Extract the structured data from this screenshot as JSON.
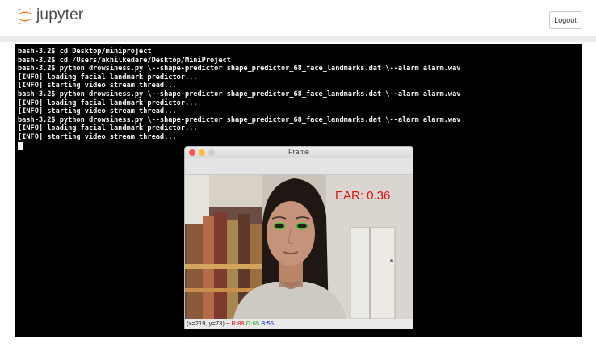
{
  "header": {
    "brand": "jupyter",
    "logout_label": "Logout"
  },
  "terminal": {
    "lines": [
      "bash-3.2$ cd Desktop/miniproject",
      "bash-3.2$ cd /Users/akhilkedare/Desktop/MiniProject",
      "bash-3.2$ python drowsiness.py \\--shape-predictor shape_predictor_68_face_landmarks.dat \\--alarm alarm.wav",
      "[INFO] loading facial landmark predictor...",
      "[INFO] starting video stream thread...",
      "bash-3.2$ python drowsiness.py \\--shape-predictor shape_predictor_68_face_landmarks.dat \\--alarm alarm.wav",
      "[INFO] loading facial landmark predictor...",
      "[INFO] starting video stream thread...",
      "bash-3.2$ python drowsiness.py \\--shape-predictor shape_predictor_68_face_landmarks.dat \\--alarm alarm.wav",
      "[INFO] loading facial landmark predictor...",
      "[INFO] starting video stream thread..."
    ]
  },
  "frame_window": {
    "title": "Frame",
    "ear_text": "EAR: 0.36",
    "status": {
      "coords": "(x=219, y=73) ~",
      "r": "R:88",
      "g": "G:65",
      "b": "B:55"
    }
  },
  "colors": {
    "terminal_bg": "#000000",
    "terminal_text": "#f2f2f2",
    "ear_text": "#e01010",
    "eye_markers": "#22cc22",
    "jupyter_orange": "#f37726"
  }
}
